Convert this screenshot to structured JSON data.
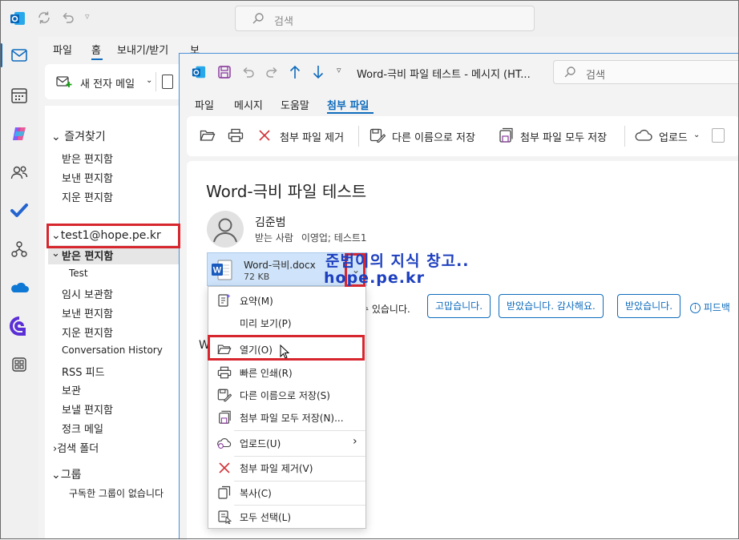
{
  "colors": {
    "accent": "#0f6cbd",
    "highlight": "#d7262e",
    "watermark": "#1d3fbf",
    "attachment_bg": "#cfe4fa"
  },
  "main_window": {
    "search_placeholder": "검색",
    "ribbon_tabs": [
      "파일",
      "홈",
      "보내기/받기",
      "보기",
      "도움말"
    ],
    "new_mail_label": "새 전자 메일",
    "nav_icons": [
      "mail-icon",
      "calendar-icon",
      "copilot-icon",
      "people-icon",
      "todo-icon",
      "org-icon",
      "onedrive-icon",
      "loop-icon",
      "apps-icon"
    ]
  },
  "folders": {
    "favorites_header": "즐겨찾기",
    "favorites": [
      "받은 편지함",
      "보낸 편지함",
      "지운 편지함"
    ],
    "account": "test1@hope.pe.kr",
    "account_folders": [
      {
        "label": "받은 편지함",
        "indent": 1,
        "selected": true
      },
      {
        "label": "Test",
        "indent": 2
      },
      {
        "label": "임시 보관함",
        "indent": 1
      },
      {
        "label": "보낸 편지함",
        "indent": 1
      },
      {
        "label": "지운 편지함",
        "indent": 1
      },
      {
        "label": "Conversation History",
        "indent": 1
      },
      {
        "label": "RSS 피드",
        "indent": 1
      },
      {
        "label": "보관",
        "indent": 1
      },
      {
        "label": "보낼 편지함",
        "indent": 1
      },
      {
        "label": "정크 메일",
        "indent": 1
      }
    ],
    "search_folders": "검색 폴더",
    "groups_header": "그룹",
    "groups_empty": "구독한 그룹이 없습니다"
  },
  "message_window": {
    "title": "Word-극비 파일 테스트  -  메시지 (HT...",
    "search_placeholder": "검색",
    "tabs": [
      "파일",
      "메시지",
      "도움말",
      "첨부 파일"
    ],
    "ribbon": {
      "remove_attachment": "첨부 파일 제거",
      "save_as": "다른 이름으로 저장",
      "save_all": "첨부 파일 모두 저장",
      "upload": "업로드"
    },
    "subject": "Word-극비 파일 테스트",
    "sender": "김준범",
    "recipients_label": "받는 사람",
    "recipients": "이영업; 테스트1",
    "attachment": {
      "name": "Word-극비.docx",
      "size": "72 KB"
    },
    "quick_reply_text": "수 있습니다.",
    "quick_replies": [
      "고맙습니다.",
      "받았습니다. 감사해요.",
      "받았습니다."
    ],
    "feedback": "피드백",
    "body_start": "W"
  },
  "context_menu": {
    "items": [
      {
        "label": "요약(M)",
        "icon": "summary-icon"
      },
      {
        "label": "미리 보기(P)",
        "icon": ""
      },
      {
        "label": "열기(O)",
        "icon": "folder-open-icon",
        "highlighted": true
      },
      {
        "label": "빠른 인쇄(R)",
        "icon": "printer-icon"
      },
      {
        "label": "다른 이름으로 저장(S)",
        "icon": "save-as-icon"
      },
      {
        "label": "첨부 파일 모두 저장(N)...",
        "icon": "save-all-icon"
      },
      {
        "label": "업로드(U)",
        "icon": "upload-icon",
        "submenu": true
      },
      {
        "label": "첨부 파일 제거(V)",
        "icon": "remove-icon"
      },
      {
        "label": "복사(C)",
        "icon": "copy-icon"
      },
      {
        "label": "모두 선택(L)",
        "icon": "select-all-icon"
      }
    ]
  },
  "watermark": {
    "line1": "준범이의 지식 창고..",
    "line2": "hope.pe.kr"
  }
}
